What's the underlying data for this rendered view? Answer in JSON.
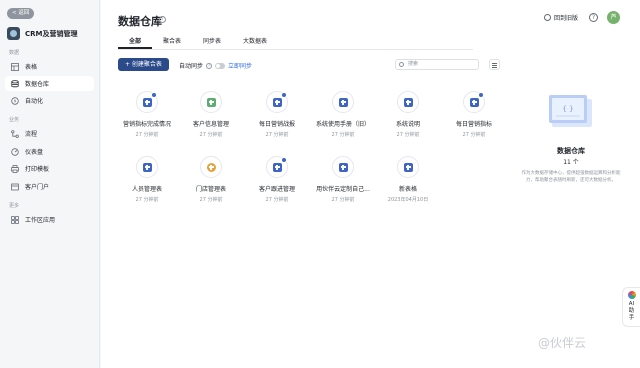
{
  "sidebar": {
    "back_label": "< 返回",
    "app_title": "CRM及营销管理",
    "sections": {
      "data": "数据",
      "business": "业务",
      "more": "更多"
    },
    "items": [
      {
        "label": "表格",
        "icon": "table-icon"
      },
      {
        "label": "数据仓库",
        "icon": "database-icon"
      },
      {
        "label": "自动化",
        "icon": "automation-icon"
      },
      {
        "label": "流程",
        "icon": "flow-icon"
      },
      {
        "label": "仪表盘",
        "icon": "dashboard-icon"
      },
      {
        "label": "打印模板",
        "icon": "print-icon"
      },
      {
        "label": "客户门户",
        "icon": "portal-icon"
      },
      {
        "label": "工作区应用",
        "icon": "apps-icon"
      }
    ]
  },
  "header": {
    "title": "数据仓库",
    "old_version": "回到旧版",
    "avatar_initial": "芦"
  },
  "tabs": [
    "全部",
    "聚合表",
    "同步表",
    "大数据表"
  ],
  "toolbar": {
    "create_label": "+ 创建聚合表",
    "auto_sync": "自动同步",
    "sync_now": "立即同步",
    "search_placeholder": "搜索"
  },
  "cards": [
    {
      "name": "营销指标完成情况",
      "time": "27 分钟前",
      "icon": "table-badge-icon",
      "color": "#3d64c7"
    },
    {
      "name": "客户信息管理",
      "time": "27 分钟前",
      "icon": "chart-icon",
      "color": "#5cad6f"
    },
    {
      "name": "每日营销战报",
      "time": "27 分钟前",
      "icon": "table-badge-icon",
      "color": "#3d64c7"
    },
    {
      "name": "系统使用手册（旧）",
      "time": "27 分钟前",
      "icon": "table-icon",
      "color": "#3d64c7"
    },
    {
      "name": "系统说明",
      "time": "27 分钟前",
      "icon": "table-icon",
      "color": "#3d64c7"
    },
    {
      "name": "每日营销指标",
      "time": "27 分钟前",
      "icon": "table-badge-icon",
      "color": "#3d64c7"
    },
    {
      "name": "人员管理表",
      "time": "27 分钟前",
      "icon": "table-icon",
      "color": "#3d64c7"
    },
    {
      "name": "门店管理表",
      "time": "27 分钟前",
      "icon": "group-icon",
      "color": "#e7a23d"
    },
    {
      "name": "客户跟进管理",
      "time": "27 分钟前",
      "icon": "table-badge-icon",
      "color": "#3d64c7"
    },
    {
      "name": "用伙伴云定制自己...",
      "time": "27 分钟前",
      "icon": "table-icon",
      "color": "#3d64c7"
    },
    {
      "name": "新表格",
      "time": "2023年04月10日",
      "icon": "table-icon",
      "color": "#3d64c7"
    }
  ],
  "panel": {
    "title": "数据仓库",
    "count": "11 个",
    "desc": "作为大数据存储中心，提供超强数据运算和分析能力，帮助聚合表随时刷新，还可大数据分析。"
  },
  "ai_label_1": "AI",
  "ai_label_2": "助",
  "ai_label_3": "手",
  "watermark": "@伙伴云"
}
